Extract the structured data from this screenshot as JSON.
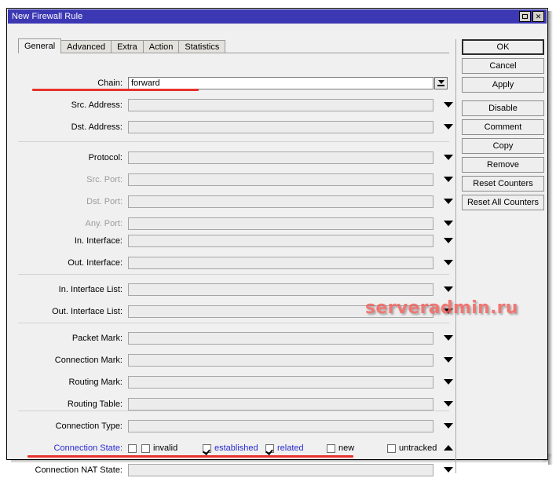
{
  "window": {
    "title": "New Firewall Rule",
    "maximize_icon": "maximize-icon",
    "close_icon": "close-icon",
    "close_glyph": "✕"
  },
  "tabs": [
    {
      "label": "General",
      "active": true
    },
    {
      "label": "Advanced",
      "active": false
    },
    {
      "label": "Extra",
      "active": false
    },
    {
      "label": "Action",
      "active": false
    },
    {
      "label": "Statistics",
      "active": false
    }
  ],
  "fields": [
    {
      "label": "Chain:",
      "value": "forward",
      "state": "editable",
      "control": "combo-button",
      "highlight": true
    },
    {
      "label": "Src. Address:",
      "value": "",
      "state": "normal",
      "control": "arrow"
    },
    {
      "label": "Dst. Address:",
      "value": "",
      "state": "normal",
      "control": "arrow"
    },
    {
      "label": "Protocol:",
      "value": "",
      "state": "normal",
      "control": "arrow"
    },
    {
      "label": "Src. Port:",
      "value": "",
      "state": "disabled",
      "control": "arrow"
    },
    {
      "label": "Dst. Port:",
      "value": "",
      "state": "disabled",
      "control": "arrow"
    },
    {
      "label": "Any. Port:",
      "value": "",
      "state": "disabled",
      "control": "arrow"
    },
    {
      "label": "In. Interface:",
      "value": "",
      "state": "normal",
      "control": "arrow"
    },
    {
      "label": "Out. Interface:",
      "value": "",
      "state": "normal",
      "control": "arrow"
    },
    {
      "label": "In. Interface List:",
      "value": "",
      "state": "normal",
      "control": "arrow"
    },
    {
      "label": "Out. Interface List:",
      "value": "",
      "state": "normal",
      "control": "arrow"
    },
    {
      "label": "Packet Mark:",
      "value": "",
      "state": "normal",
      "control": "arrow"
    },
    {
      "label": "Connection Mark:",
      "value": "",
      "state": "normal",
      "control": "arrow"
    },
    {
      "label": "Routing Mark:",
      "value": "",
      "state": "normal",
      "control": "arrow"
    },
    {
      "label": "Routing Table:",
      "value": "",
      "state": "normal",
      "control": "arrow"
    },
    {
      "label": "Connection Type:",
      "value": "",
      "state": "normal",
      "control": "arrow"
    }
  ],
  "connection_state": {
    "label": "Connection State:",
    "label_color": "#2a2ad0",
    "negate_checkbox_checked": false,
    "options": [
      {
        "label": "invalid",
        "checked": false,
        "highlighted": false
      },
      {
        "label": "established",
        "checked": true,
        "highlighted": true
      },
      {
        "label": "related",
        "checked": true,
        "highlighted": true
      },
      {
        "label": "new",
        "checked": false,
        "highlighted": false
      },
      {
        "label": "untracked",
        "checked": false,
        "highlighted": false
      }
    ],
    "control": "arrow-up"
  },
  "connection_nat_state": {
    "label": "Connection NAT State:",
    "value": "",
    "control": "arrow"
  },
  "buttons": [
    {
      "label": "OK",
      "default": true,
      "gap": false
    },
    {
      "label": "Cancel",
      "default": false,
      "gap": false
    },
    {
      "label": "Apply",
      "default": false,
      "gap": false
    },
    {
      "label": "Disable",
      "default": false,
      "gap": true
    },
    {
      "label": "Comment",
      "default": false,
      "gap": false
    },
    {
      "label": "Copy",
      "default": false,
      "gap": false
    },
    {
      "label": "Remove",
      "default": false,
      "gap": false
    },
    {
      "label": "Reset Counters",
      "default": false,
      "gap": false
    },
    {
      "label": "Reset All Counters",
      "default": false,
      "gap": false
    }
  ],
  "watermark": {
    "text": "serveradmin.ru",
    "color": "#f0635e"
  },
  "annotations": {
    "accent_color": "#e8322c"
  }
}
